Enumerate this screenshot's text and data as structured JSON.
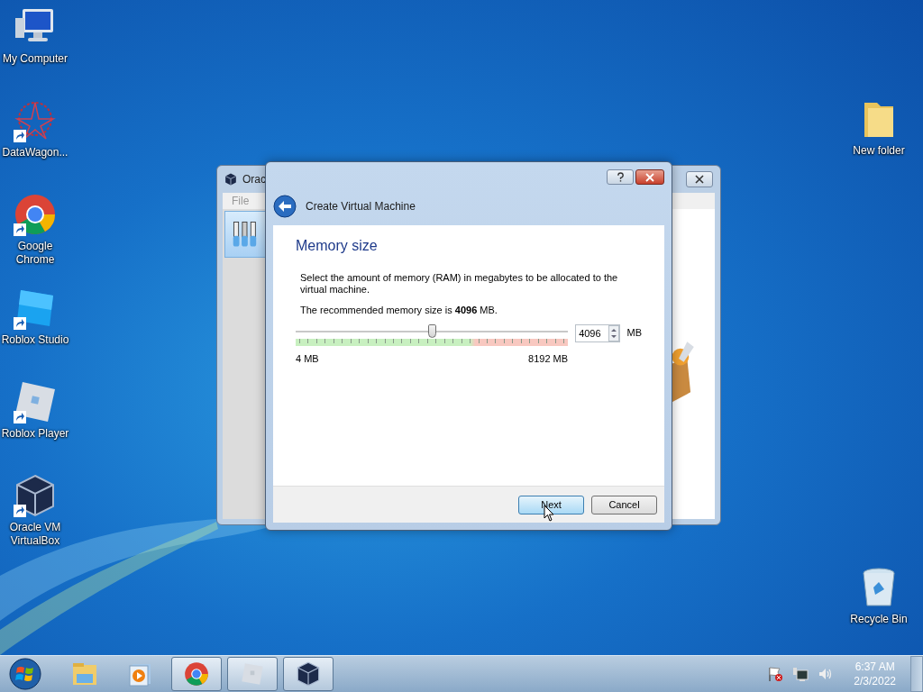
{
  "desktop_icons_left": [
    {
      "label": "My Computer",
      "kind": "computer",
      "shortcut": false
    },
    {
      "label": "DataWagon...",
      "kind": "star",
      "shortcut": true
    },
    {
      "label": "Google Chrome",
      "kind": "chrome",
      "shortcut": true
    },
    {
      "label": "Roblox Studio",
      "kind": "studio",
      "shortcut": true
    },
    {
      "label": "Roblox Player",
      "kind": "player",
      "shortcut": true
    },
    {
      "label": "Oracle VM VirtualBox",
      "kind": "cube",
      "shortcut": true
    }
  ],
  "desktop_icons_right": [
    {
      "label": "New folder",
      "kind": "folder",
      "shortcut": false
    },
    {
      "label": "Recycle Bin",
      "kind": "bin",
      "shortcut": false
    }
  ],
  "background_window": {
    "title": "Orac",
    "menu": [
      "File"
    ]
  },
  "dialog": {
    "title": "Create Virtual Machine",
    "heading": "Memory size",
    "description": "Select the amount of memory (RAM) in megabytes to be allocated to the virtual machine.",
    "recommendation": "The recommended memory size is **4096** MB.",
    "slider": {
      "level": 0.5,
      "min_label": "4 MB",
      "max_label": "8192 MB"
    },
    "spinbox": {
      "value": "4096",
      "unit": "MB"
    },
    "buttons": [
      {
        "label": "Next",
        "focused": true
      },
      {
        "label": "Cancel",
        "focused": false
      }
    ]
  },
  "taskbar": {
    "items": [
      {
        "kind": "explorer",
        "open": false
      },
      {
        "kind": "media",
        "open": false
      },
      {
        "kind": "chrome",
        "open": true
      },
      {
        "kind": "player",
        "open": true
      },
      {
        "kind": "cube",
        "open": true
      }
    ],
    "tray": {
      "time": "6:37 AM",
      "date": "2/3/2022"
    }
  }
}
